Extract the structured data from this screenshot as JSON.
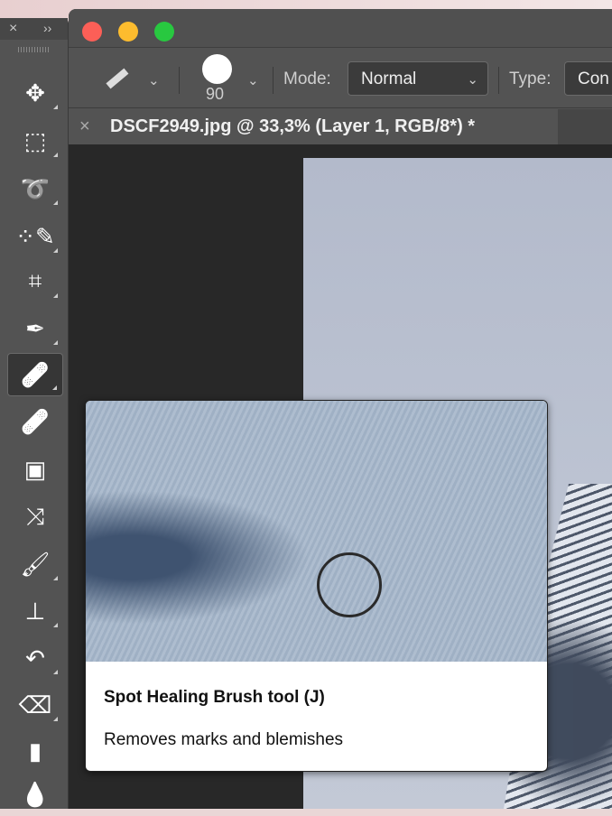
{
  "options_bar": {
    "brush_size": "90",
    "mode_label": "Mode:",
    "mode_value": "Normal",
    "type_label": "Type:",
    "type_value": "Con"
  },
  "document_tab": {
    "title": "DSCF2949.jpg @ 33,3% (Layer 1, RGB/8*) *",
    "close": "×"
  },
  "tools_panel": {
    "close": "×",
    "expand": "››",
    "tools": [
      {
        "name": "move-tool",
        "icon": "✥"
      },
      {
        "name": "marquee-tool",
        "icon": "⬚"
      },
      {
        "name": "lasso-tool",
        "icon": "➰"
      },
      {
        "name": "quick-selection-tool",
        "icon": "⁘✎"
      },
      {
        "name": "crop-tool",
        "icon": "⌗"
      },
      {
        "name": "eyedropper-tool",
        "icon": "✒"
      },
      {
        "name": "spot-healing-brush-tool",
        "icon": "🩹"
      },
      {
        "name": "healing-brush-tool",
        "icon": "🩹"
      },
      {
        "name": "patch-tool",
        "icon": "▣"
      },
      {
        "name": "content-aware-move-tool",
        "icon": "⤨"
      },
      {
        "name": "brush-tool",
        "icon": "🖌"
      },
      {
        "name": "clone-stamp-tool",
        "icon": "⊥"
      },
      {
        "name": "history-brush-tool",
        "icon": "↶"
      },
      {
        "name": "eraser-tool",
        "icon": "⌫"
      },
      {
        "name": "gradient-tool",
        "icon": "▮"
      },
      {
        "name": "blur-tool",
        "icon": "💧"
      }
    ]
  },
  "tooltip": {
    "title": "Spot Healing Brush tool (J)",
    "description": "Removes marks and blemishes"
  }
}
